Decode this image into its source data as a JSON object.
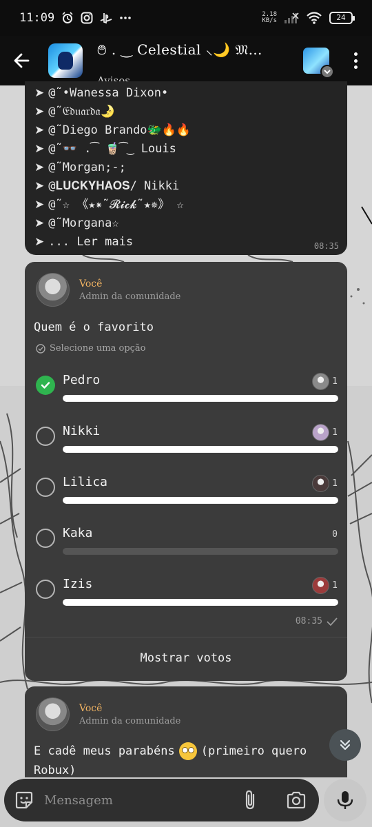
{
  "status_bar": {
    "time": "11:09",
    "net_speed_value": "2.18",
    "net_speed_unit": "KB/s",
    "battery": "24"
  },
  "header": {
    "title": "࿉ . ‿ Celestial ⸜🌙 𝔐…",
    "subtitle": "Avisos"
  },
  "previous_message": {
    "mentions": [
      "@˜•Wanessa Dixon•",
      "@˜𝔈𝔡𝔲𝔞𝔯𝔡𝔞🌛",
      "@˜Diego Brando🐲🔥🔥",
      "@˜👓 .͡ 🧋͡‿ Louis",
      "@˜Morgan;-;",
      "@𝐋𝐔𝐂𝐊𝐘𝐇𝐀𝐎𝐒/ Nikki",
      "@˜☆ 《★✷˜𝓡𝓲𝓬𝓴˜★✵》 ☆",
      "@˜Morgana☆"
    ],
    "read_more": "... Ler mais",
    "time": "08:35"
  },
  "poll": {
    "sender_name": "Você",
    "sender_role": "Admin da comunidade",
    "question": "Quem é o favorito",
    "hint": "Selecione uma opção",
    "options": [
      {
        "label": "Pedro",
        "votes": "1",
        "share": 1.0,
        "selected": true,
        "voter_color": "#8a8a8a"
      },
      {
        "label": "Nikki",
        "votes": "1",
        "share": 1.0,
        "selected": false,
        "voter_color": "#b9a3c9"
      },
      {
        "label": "Lilica",
        "votes": "1",
        "share": 1.0,
        "selected": false,
        "voter_color": "#4a3a3a"
      },
      {
        "label": "Kaka",
        "votes": "0",
        "share": 0.0,
        "selected": false,
        "voter_color": ""
      },
      {
        "label": "Izis",
        "votes": "1",
        "share": 1.0,
        "selected": false,
        "voter_color": "#9b3b3b"
      }
    ],
    "time": "08:35",
    "show_votes": "Mostrar votos"
  },
  "next_message": {
    "sender_name": "Você",
    "sender_role": "Admin da comunidade",
    "text_before": "E cadê meus parabéns",
    "emoji_name": "face-with-rolling-eyes",
    "text_after": "(primeiro quero Robux)"
  },
  "composer": {
    "placeholder": "Mensagem"
  },
  "colors": {
    "accent_name": "#f2b463",
    "check_green": "#2fb44f",
    "bubble": "#3b3b3b"
  }
}
